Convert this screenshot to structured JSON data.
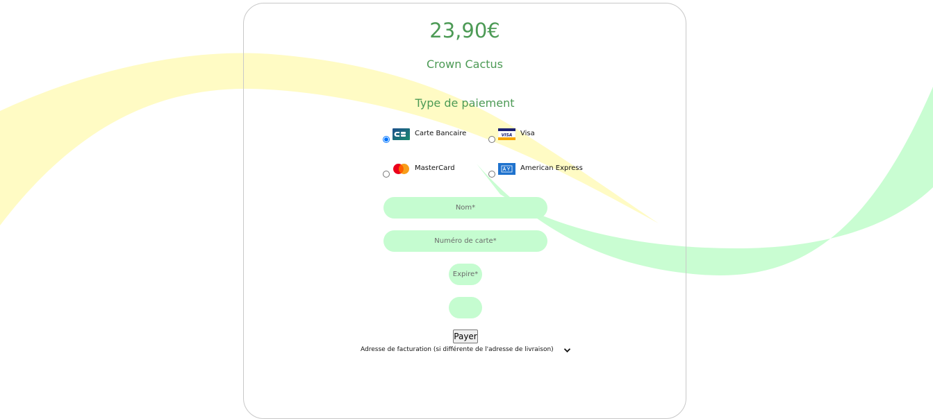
{
  "order": {
    "price": "23,90€",
    "product_name": "Crown Cactus"
  },
  "payment": {
    "heading": "Type de paiement",
    "options": [
      {
        "label": "Carte Bancaire",
        "icon": "cb-card-icon",
        "selected": true
      },
      {
        "label": "Visa",
        "icon": "visa-card-icon",
        "selected": false
      },
      {
        "label": "MasterCard",
        "icon": "mastercard-icon",
        "selected": false
      },
      {
        "label": "American Express",
        "icon": "amex-card-icon",
        "selected": false
      }
    ]
  },
  "form": {
    "name_placeholder": "Nom*",
    "card_number_placeholder": "Numéro de carte*",
    "expiry_placeholder": "Expire*",
    "cvc_placeholder": "",
    "submit_label": "Payer"
  },
  "billing": {
    "toggle_label": "Adresse de facturation (si différente de l'adresse de livraison)",
    "icon": "chevron-down-icon"
  },
  "colors": {
    "accent_text": "#4c9a55",
    "field_bg": "#c5fcd0",
    "wave_yellow": "#fff9c4",
    "wave_green": "#c5fcd0"
  }
}
